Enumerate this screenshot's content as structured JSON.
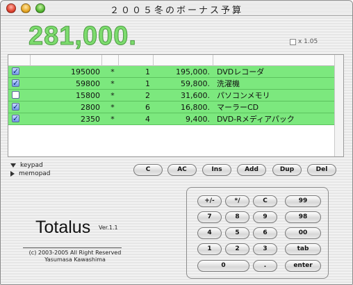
{
  "window": {
    "title": "２００５冬のボーナス予算"
  },
  "total": {
    "value": "281,000.",
    "multiplier_label": "x 1.05",
    "multiplier_checked": false
  },
  "table": {
    "rows": [
      {
        "checked": true,
        "price": "195000",
        "op": "*",
        "qty": "1",
        "subtotal": "195,000.",
        "name": "DVDレコーダ"
      },
      {
        "checked": true,
        "price": "59800",
        "op": "*",
        "qty": "1",
        "subtotal": "59,800.",
        "name": "洗濯機"
      },
      {
        "checked": false,
        "price": "15800",
        "op": "*",
        "qty": "2",
        "subtotal": "31,600.",
        "name": "パソコンメモリ"
      },
      {
        "checked": true,
        "price": "2800",
        "op": "*",
        "qty": "6",
        "subtotal": "16,800.",
        "name": "マーラーCD"
      },
      {
        "checked": true,
        "price": "2350",
        "op": "*",
        "qty": "4",
        "subtotal": "9,400.",
        "name": "DVD-Rメディアパック"
      }
    ]
  },
  "toggles": {
    "keypad": "keypad",
    "memopad": "memopad"
  },
  "actions": {
    "c": "C",
    "ac": "AC",
    "ins": "Ins",
    "add": "Add",
    "dup": "Dup",
    "del": "Del"
  },
  "keypad": {
    "k_sign": "+/-",
    "k_slash": "*/",
    "k_c": "C",
    "k_99": "99",
    "k_7": "7",
    "k_8": "8",
    "k_9": "9",
    "k_98": "98",
    "k_4": "4",
    "k_5": "5",
    "k_6": "6",
    "k_00": "00",
    "k_1": "1",
    "k_2": "2",
    "k_3": "3",
    "k_tab": "tab",
    "k_0": "0",
    "k_dot": ".",
    "k_enter": "enter"
  },
  "brand": {
    "name": "Totalus",
    "version": "Ver.1.1",
    "copyright": "(c) 2003-2005 All Right Reserved",
    "author": "Yasumasa Kawashima"
  },
  "colors": {
    "row_green": "#7ce87e",
    "total_green": "#7ddc6e"
  }
}
